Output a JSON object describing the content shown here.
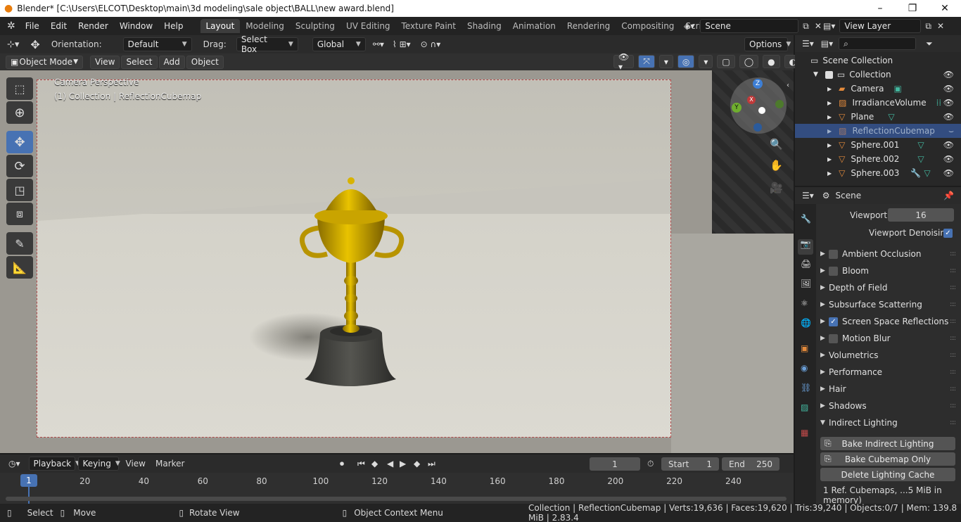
{
  "window": {
    "title": "Blender* [C:\\Users\\ELCOT\\Desktop\\main\\3d modeling\\sale object\\BALL\\new award.blend]",
    "minimize": "–",
    "maximize": "❐",
    "close": "✕"
  },
  "menu": {
    "items": [
      "File",
      "Edit",
      "Render",
      "Window",
      "Help"
    ],
    "workspaces": [
      "Layout",
      "Modeling",
      "Sculpting",
      "UV Editing",
      "Texture Paint",
      "Shading",
      "Animation",
      "Rendering",
      "Compositing",
      "Scripting"
    ],
    "active_workspace": "Layout",
    "add_workspace": "+",
    "scene": "Scene",
    "view_layer": "View Layer"
  },
  "tool_header": {
    "orientation_label": "Orientation:",
    "orientation_value": "Default",
    "drag_label": "Drag:",
    "drag_value": "Select Box",
    "transform_space": "Global",
    "options": "Options"
  },
  "viewport_header": {
    "mode": "Object Mode",
    "menus": [
      "View",
      "Select",
      "Add",
      "Object"
    ]
  },
  "viewport": {
    "camera_label": "Camera Perspective",
    "collection_label": "(1) Collection | ReflectionCubemap",
    "gizmo": {
      "z": "Z",
      "x": "X",
      "y": "Y"
    }
  },
  "outliner": {
    "root": "Scene Collection",
    "collection": "Collection",
    "objects": [
      "Camera",
      "IrradianceVolume",
      "Plane",
      "ReflectionCubemap",
      "Sphere.001",
      "Sphere.002",
      "Sphere.003"
    ],
    "selected": "ReflectionCubemap"
  },
  "properties": {
    "context": "Scene",
    "viewport_label": "Viewport",
    "viewport_value": "16",
    "viewport_denoising": "Viewport Denoising",
    "sections": [
      {
        "label": "Ambient Occlusion",
        "checkbox": true,
        "checked": false
      },
      {
        "label": "Bloom",
        "checkbox": true,
        "checked": false
      },
      {
        "label": "Depth of Field",
        "checkbox": false
      },
      {
        "label": "Subsurface Scattering",
        "checkbox": false
      },
      {
        "label": "Screen Space Reflections",
        "checkbox": true,
        "checked": true
      },
      {
        "label": "Motion Blur",
        "checkbox": true,
        "checked": false
      },
      {
        "label": "Volumetrics",
        "checkbox": false
      },
      {
        "label": "Performance",
        "checkbox": false
      },
      {
        "label": "Hair",
        "checkbox": false
      },
      {
        "label": "Shadows",
        "checkbox": false
      },
      {
        "label": "Indirect Lighting",
        "checkbox": false,
        "expanded": true
      }
    ],
    "bake_indirect": "Bake Indirect Lighting",
    "bake_cubemap": "Bake Cubemap Only",
    "delete_cache": "Delete Lighting Cache",
    "cache_info": "1 Ref. Cubemaps, ...5 MiB in memory)"
  },
  "timeline": {
    "menus": [
      "Playback",
      "Keying",
      "View",
      "Marker"
    ],
    "current_frame": "1",
    "start_label": "Start",
    "start": "1",
    "end_label": "End",
    "end": "250",
    "ticks": [
      "20",
      "40",
      "60",
      "80",
      "100",
      "120",
      "140",
      "160",
      "180",
      "200",
      "220",
      "240"
    ],
    "playhead": "1"
  },
  "status": {
    "select": "Select",
    "move": "Move",
    "rotate": "Rotate View",
    "context_menu": "Object Context Menu",
    "stats": "Collection | ReflectionCubemap | Verts:19,636 | Faces:19,620 | Tris:39,240 | Objects:0/7 | Mem: 139.8 MiB | 2.83.4"
  },
  "colors": {
    "accent": "#4772b3",
    "selection": "#334d80",
    "gold": "#c9a400",
    "base": "#3a3a38"
  }
}
